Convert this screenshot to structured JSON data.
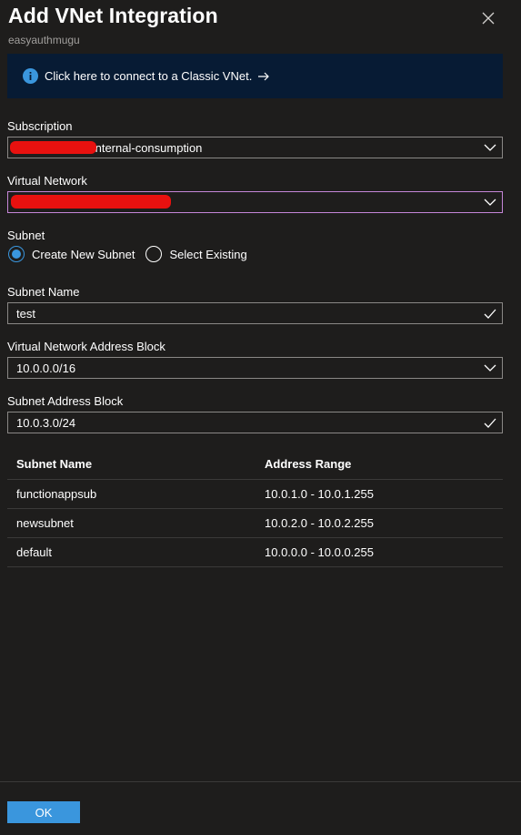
{
  "header": {
    "title": "Add VNet Integration",
    "subtitle": "easyauthmugu"
  },
  "banner": {
    "text": "Click here to connect to a Classic VNet.",
    "icon": "info-icon",
    "arrow_icon": "arrow-right-icon"
  },
  "form": {
    "subscription": {
      "label": "Subscription",
      "value": "Internal-consumption"
    },
    "virtual_network": {
      "label": "Virtual Network",
      "value": ""
    },
    "subnet": {
      "label": "Subnet",
      "options": [
        "Create New Subnet",
        "Select Existing"
      ],
      "selected": "Create New Subnet"
    },
    "subnet_name": {
      "label": "Subnet Name",
      "value": "test"
    },
    "vnet_address_block": {
      "label": "Virtual Network Address Block",
      "value": "10.0.0.0/16"
    },
    "subnet_address_block": {
      "label": "Subnet Address Block",
      "value": "10.0.3.0/24"
    }
  },
  "table": {
    "headers": [
      "Subnet Name",
      "Address Range"
    ],
    "rows": [
      [
        "functionappsub",
        "10.0.1.0 - 10.0.1.255"
      ],
      [
        "newsubnet",
        "10.0.2.0 - 10.0.2.255"
      ],
      [
        "default",
        "10.0.0.0 - 10.0.0.255"
      ]
    ]
  },
  "footer": {
    "ok_label": "OK"
  },
  "colors": {
    "background": "#1e1d1c",
    "banner": "#071b34",
    "accent": "#3a96dd",
    "focus_border": "#c586d8",
    "redaction": "#e8110f"
  }
}
